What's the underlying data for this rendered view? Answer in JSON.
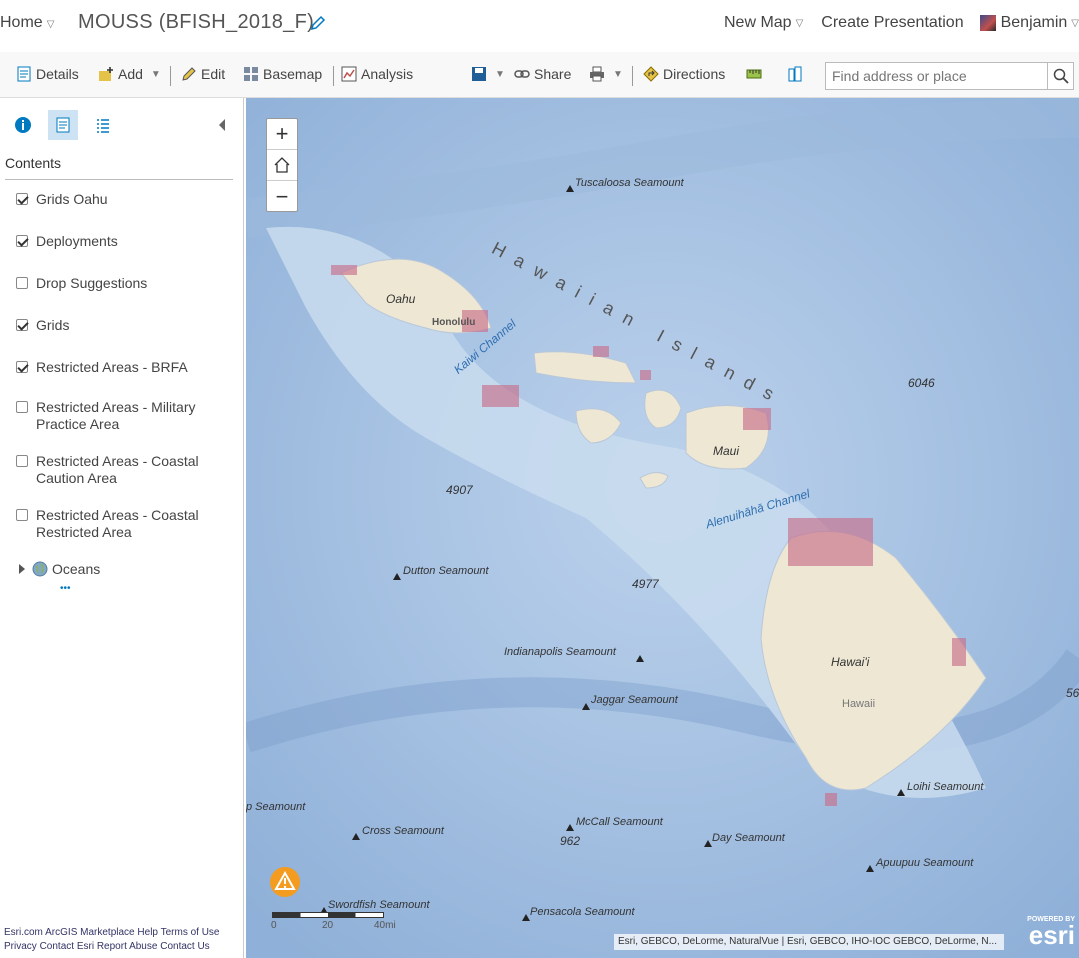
{
  "topbar": {
    "home": "Home",
    "title": "MOUSS (BFISH_2018_F)",
    "new_map": "New Map",
    "create_presentation": "Create Presentation",
    "user": "Benjamin"
  },
  "toolbar": {
    "details": "Details",
    "add": "Add",
    "edit": "Edit",
    "basemap": "Basemap",
    "analysis": "Analysis",
    "share": "Share",
    "directions": "Directions",
    "search_placeholder": "Find address or place"
  },
  "sidebar": {
    "contents_label": "Contents",
    "layers": [
      {
        "label": "Grids Oahu",
        "checked": true
      },
      {
        "label": "Deployments",
        "checked": true
      },
      {
        "label": "Drop Suggestions",
        "checked": false
      },
      {
        "label": "Grids",
        "checked": true
      },
      {
        "label": "Restricted Areas - BRFA",
        "checked": true
      },
      {
        "label": "Restricted Areas - Military Practice Area",
        "checked": false
      },
      {
        "label": "Restricted Areas - Coastal Caution Area",
        "checked": false
      },
      {
        "label": "Restricted Areas - Coastal Restricted Area",
        "checked": false
      }
    ],
    "group": "Oceans",
    "more": "•••"
  },
  "footer": {
    "esri": "Esri.com",
    "marketplace": "ArcGIS Marketplace",
    "help": "Help",
    "terms": "Terms of Use",
    "privacy": "Privacy",
    "contact_esri": "Contact Esri",
    "report": "Report Abuse",
    "contact_us": "Contact Us"
  },
  "map": {
    "labels": {
      "islands_title": "Hawaiian Islands",
      "oahu": "Oahu",
      "honolulu": "Honolulu",
      "kaiwi": "Kaiwi Channel",
      "maui": "Maui",
      "alenuihaha": "Alenuihāhā Channel",
      "hawaii_island": "Hawai'i",
      "hawaii": "Hawaii"
    },
    "depths": [
      "6046",
      "4907",
      "4977",
      "962",
      "56"
    ],
    "seamounts": [
      "Tuscaloosa Seamount",
      "Dutton Seamount",
      "Indianapolis Seamount",
      "Jaggar Seamount",
      "Loihi Seamount",
      "p Seamount",
      "Cross Seamount",
      "McCall Seamount",
      "Day Seamount",
      "Apuupuu Seamount",
      "Swordfish Seamount",
      "Pensacola Seamount"
    ],
    "scale": {
      "zero": "0",
      "mid": "20",
      "end": "40mi"
    },
    "attribution": "Esri, GEBCO, DeLorme, NaturalVue | Esri, GEBCO, IHO-IOC GEBCO, DeLorme, N...",
    "esri_powered": "POWERED BY",
    "esri_logo": "esri",
    "zoom_in": "+",
    "zoom_out": "−"
  },
  "colors": {
    "accent": "#0079c1",
    "restricted": "#c76f8a",
    "land": "#ede7d4",
    "shelf": "#c9dcef"
  }
}
